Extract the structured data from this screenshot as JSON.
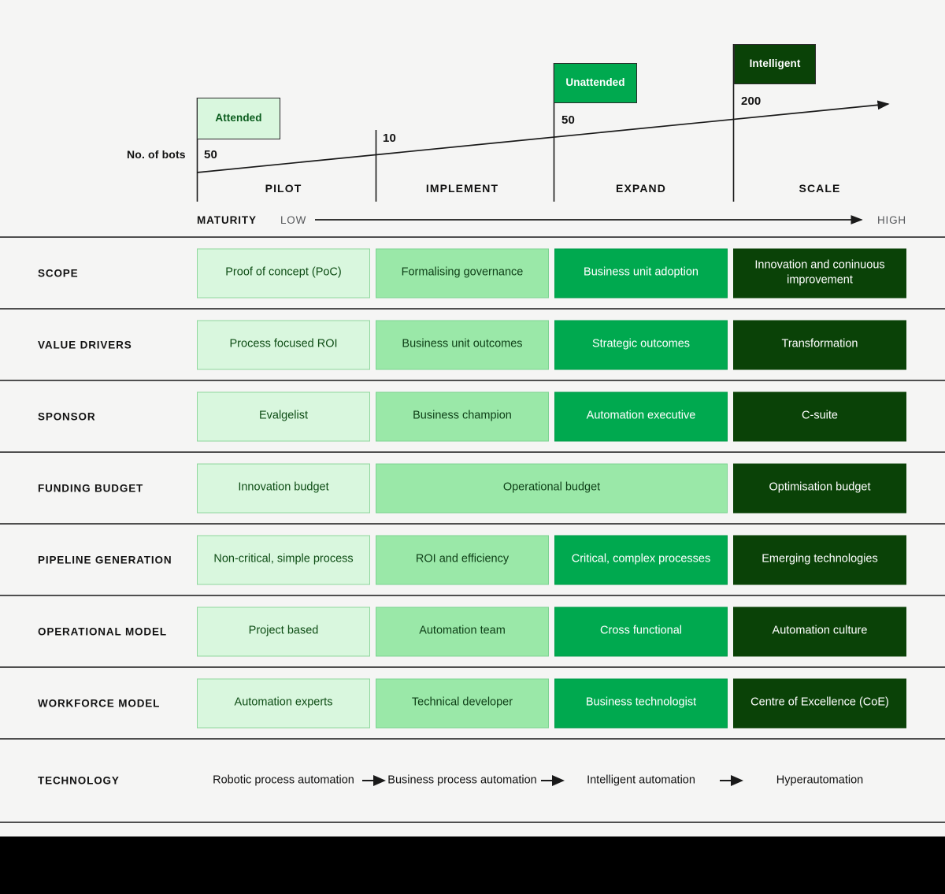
{
  "theme": {
    "background": "#f5f5f4",
    "outer_background": "#000000",
    "col1_fill": "#d9f7de",
    "col2_fill": "#9ae8a8",
    "col3_fill": "#00a94f",
    "col4_fill": "#0a4207",
    "rule_color": "#4f4f4f"
  },
  "chart_data": {
    "type": "line",
    "title": "",
    "xlabel": "MATURITY",
    "ylabel": "No. of bots",
    "axis_low_label": "LOW",
    "axis_high_label": "HIGH",
    "categories": [
      "PILOT",
      "IMPLEMENT",
      "EXPAND",
      "SCALE"
    ],
    "x": [
      "PILOT",
      "IMPLEMENT",
      "EXPAND",
      "SCALE"
    ],
    "values": [
      50,
      10,
      50,
      200
    ],
    "tick_labels": [
      "50",
      "10",
      "50",
      "200"
    ],
    "grid": false,
    "legend_position": "none",
    "annotations": [
      {
        "label": "Attended",
        "value": "50",
        "stage": "PILOT"
      },
      {
        "label": "Unattended",
        "value": "50",
        "stage": "EXPAND"
      },
      {
        "label": "Intelligent",
        "value": "200",
        "stage": "SCALE"
      }
    ],
    "series": [
      {
        "name": "No. of bots",
        "values": [
          50,
          10,
          50,
          200
        ]
      }
    ]
  },
  "header": {
    "bots_label": "No. of bots",
    "maturity_label": "MATURITY",
    "low_label": "LOW",
    "high_label": "HIGH",
    "flags": [
      {
        "label": "Attended",
        "count": "50"
      },
      {
        "label": "Unattended",
        "count": "50"
      },
      {
        "label": "Intelligent",
        "count": "200"
      }
    ],
    "mid_count": "10",
    "stages": [
      "PILOT",
      "IMPLEMENT",
      "EXPAND",
      "SCALE"
    ]
  },
  "matrix": {
    "rows": [
      {
        "label": "SCOPE",
        "cells": [
          "Proof of concept (PoC)",
          "Formalising governance",
          "Business unit adoption",
          "Innovation and coninuous improvement"
        ]
      },
      {
        "label": "VALUE DRIVERS",
        "cells": [
          "Process focused ROI",
          "Business unit outcomes",
          "Strategic outcomes",
          "Transformation"
        ]
      },
      {
        "label": "SPONSOR",
        "cells": [
          "Evalgelist",
          "Business champion",
          "Automation executive",
          "C-suite"
        ]
      },
      {
        "label": "FUNDING BUDGET",
        "cells": [
          "Innovation budget",
          "Operational budget",
          "Optimisation budget"
        ],
        "merged": true
      },
      {
        "label": "PIPELINE GENERATION",
        "cells": [
          "Non-critical, simple process",
          "ROI and efficiency",
          "Critical, complex processes",
          "Emerging technologies"
        ]
      },
      {
        "label": "OPERATIONAL MODEL",
        "cells": [
          "Project based",
          "Automation team",
          "Cross functional",
          "Automation culture"
        ]
      },
      {
        "label": "WORKFORCE MODEL",
        "cells": [
          "Automation experts",
          "Technical developer",
          "Business technologist",
          "Centre of Excellence (CoE)"
        ]
      }
    ],
    "technology_row": {
      "label": "TECHNOLOGY",
      "items": [
        "Robotic process automation",
        "Business process automation",
        "Intelligent automation",
        "Hyperautomation"
      ]
    }
  }
}
